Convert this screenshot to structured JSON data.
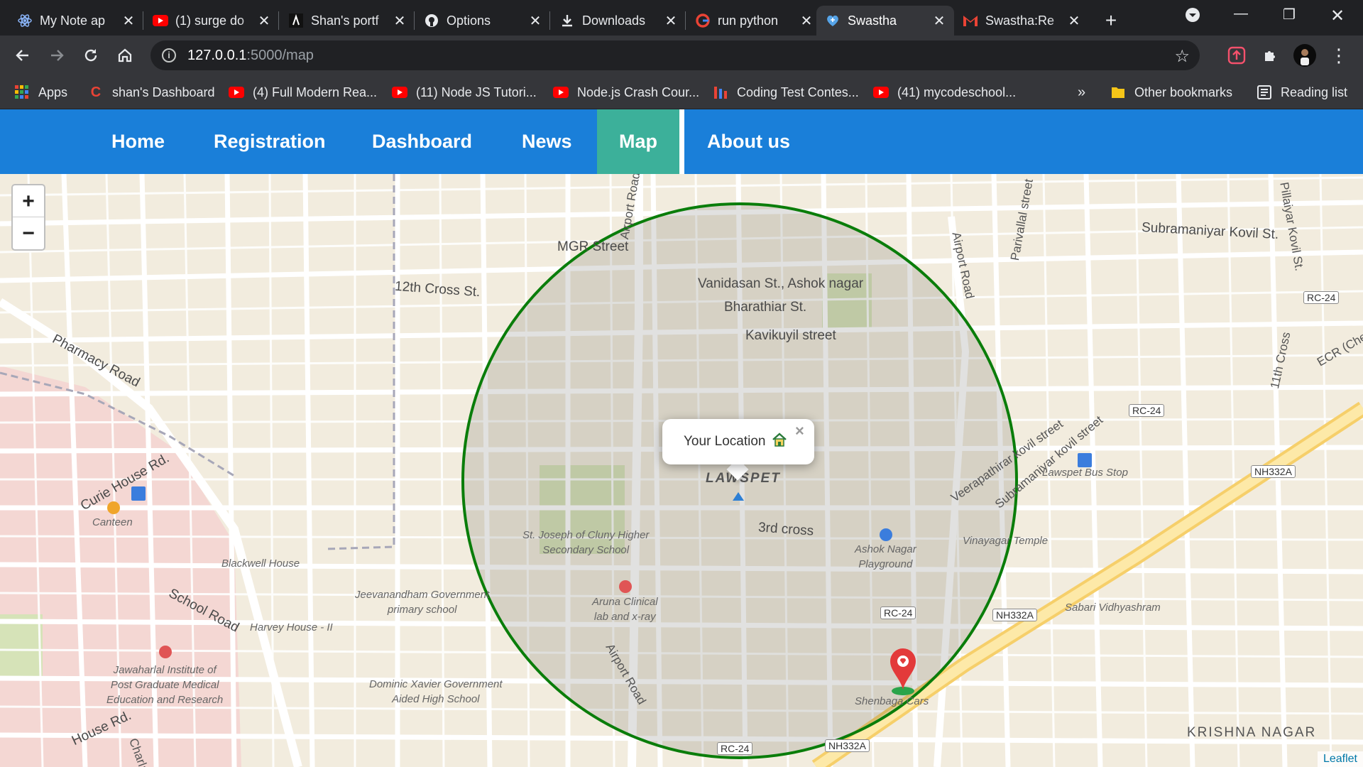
{
  "browser": {
    "tabs": [
      {
        "title": "My Note ap",
        "icon": "atom-icon"
      },
      {
        "title": "(1) surge do",
        "icon": "youtube-icon"
      },
      {
        "title": "Shan's portf",
        "icon": "portfolio-icon"
      },
      {
        "title": "Options",
        "icon": "github-icon"
      },
      {
        "title": "Downloads",
        "icon": "download-icon"
      },
      {
        "title": "run python",
        "icon": "google-icon"
      },
      {
        "title": "Swastha",
        "icon": "heart-icon",
        "active": true
      },
      {
        "title": "Swastha:Re",
        "icon": "gmail-icon"
      }
    ],
    "address": {
      "host": "127.0.0.1",
      "path": ":5000/map"
    },
    "bookmarks": [
      {
        "label": "Apps",
        "icon": "apps-grid-icon"
      },
      {
        "label": "shan's Dashboard",
        "icon": "c-logo-icon"
      },
      {
        "label": "(4) Full Modern Rea...",
        "icon": "youtube-icon"
      },
      {
        "label": "(11) Node JS Tutori...",
        "icon": "youtube-icon"
      },
      {
        "label": "Node.js Crash Cour...",
        "icon": "youtube-icon"
      },
      {
        "label": "Coding Test Contes...",
        "icon": "bars-icon"
      },
      {
        "label": "(41) mycodeschool...",
        "icon": "youtube-icon"
      }
    ],
    "overflow": "»",
    "other_bookmarks": "Other bookmarks",
    "reading_list": "Reading list"
  },
  "nav": {
    "items": [
      "Home",
      "Registration",
      "Dashboard",
      "News",
      "Map",
      "About us"
    ],
    "active": "Map"
  },
  "map": {
    "zoom_in": "+",
    "zoom_out": "−",
    "popup_text": "Your Location",
    "popup_close": "×",
    "attribution": "Leaflet",
    "area_labels": {
      "lawspet": "LAWSPET",
      "krishna_nagar": "KRISHNA NAGAR"
    },
    "street_labels": [
      "MGR Street",
      "Airport Road",
      "12th Cross St.",
      "Vanidasan St., Ashok nagar",
      "Bharathiar St.",
      "Kavikuyil street",
      "Pharmacy Road",
      "Curie House Rd.",
      "School Road",
      "House Rd.",
      "Charla",
      "3rd cross",
      "Airport Road",
      "Airport Road",
      "Parivallal street",
      "Pillaiyar Kovil St.",
      "Subramaniyar Kovil St.",
      "11th Cross",
      "Veerapathirar kovil street",
      "Subramaniyar kovil street",
      "ECR (Che"
    ],
    "poi_labels": [
      "Canteen",
      "Blackwell House",
      "Harvey House - II",
      "Jawaharlal Institute of\nPost Graduate Medical\nEducation and Research",
      "Jeevanandham Government\nprimary school",
      "Dominic Xavier Government\nAided High School",
      "St. Joseph of Cluny Higher\nSecondary School",
      "Aruna Clinical\nlab and x-ray",
      "Ashok Nagar\nPlayground",
      "Vinayagar Temple",
      "Lawspet Bus Stop",
      "Sabari Vidhyashram",
      "Shenbaga Cars"
    ],
    "road_shields": [
      "RC-24",
      "RC-24",
      "RC-24",
      "RC-24",
      "NH332A",
      "NH332A",
      "NH332A",
      "RC-24"
    ],
    "colors": {
      "circle": "#0a7d0a",
      "navbar": "#1a7fd9",
      "active_tab": "#3cb09a"
    }
  }
}
